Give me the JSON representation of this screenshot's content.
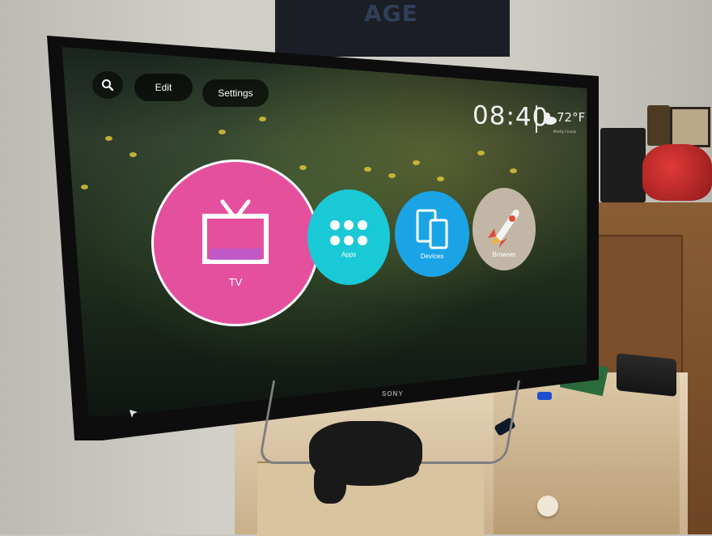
{
  "poster": {
    "text": "AGE"
  },
  "tv": {
    "brand": "SONY",
    "home": {
      "top_bar": {
        "search_icon": "search-icon",
        "edit_label": "Edit",
        "settings_label": "Settings"
      },
      "status": {
        "time": "08:40",
        "temperature": "72°F",
        "condition": "Mostly Cloudy",
        "weather_icon": "partly-cloudy-icon"
      },
      "tiles": [
        {
          "label": "TV",
          "icon": "tv-icon",
          "color": "#e5509e"
        },
        {
          "label": "Apps",
          "icon": "apps-grid-icon",
          "color": "#19c9d6"
        },
        {
          "label": "Devices",
          "icon": "devices-icon",
          "color": "#1aa4e6"
        },
        {
          "label": "Browser",
          "icon": "rocket-icon",
          "color": "#c2b7a6"
        }
      ],
      "nav_icon": "navigation-arrow-icon"
    }
  }
}
